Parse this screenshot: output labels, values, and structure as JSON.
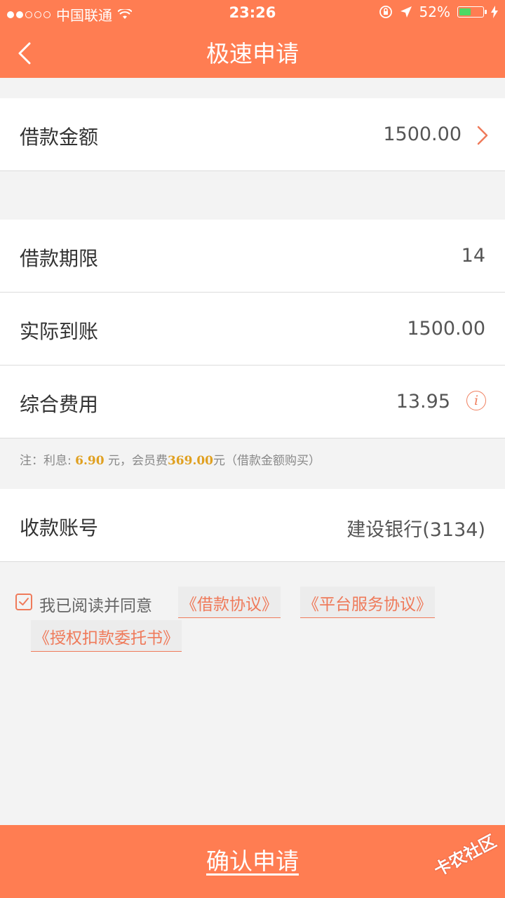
{
  "status_bar": {
    "carrier": "中国联通",
    "time": "23:26",
    "battery_percent": "52%",
    "battery_level": 0.52,
    "signal_bars_filled": 2,
    "signal_bars_total": 5
  },
  "nav": {
    "title": "极速申请",
    "back_icon": "chevron-left-icon"
  },
  "loan": {
    "amount_label": "借款金额",
    "amount_value": "1500.00"
  },
  "details": {
    "term_label": "借款期限",
    "term_value": "14",
    "received_label": "实际到账",
    "received_value": "1500.00",
    "fee_label": "综合费用",
    "fee_value": "13.95",
    "info_icon_glyph": "i"
  },
  "note": {
    "prefix": "注：利息: ",
    "interest": "6.90",
    "mid": " 元，会员费",
    "member_fee": "369.00",
    "suffix": "元（借款金额购买）"
  },
  "account": {
    "label": "收款账号",
    "value": "建设银行(3134)"
  },
  "agreement": {
    "checked": true,
    "text": "我已阅读并同意",
    "link_loan": "《借款协议》",
    "link_platform": "《平台服务协议》",
    "link_authorization": "《授权扣款委托书》"
  },
  "footer": {
    "confirm_label": "确认申请"
  },
  "watermark": {
    "text": "卡农社区"
  },
  "colors": {
    "brand": "#ff7d52",
    "link": "#ef7a5a",
    "highlight": "#e0a020",
    "battery": "#4cd964"
  }
}
